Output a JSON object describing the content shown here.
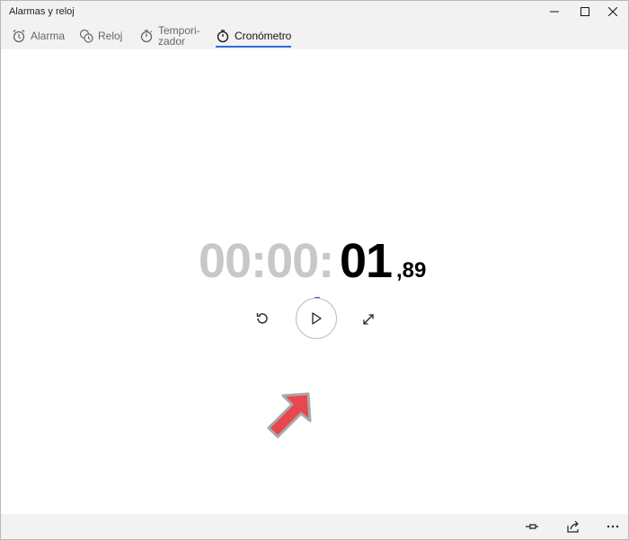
{
  "app": {
    "title": "Alarmas y reloj"
  },
  "tabs": [
    {
      "label": "Alarma",
      "icon": "alarm-icon",
      "active": false
    },
    {
      "label": "Reloj",
      "icon": "world-clock-icon",
      "active": false
    },
    {
      "label": "Tempori-\nzador",
      "icon": "timer-icon",
      "active": false
    },
    {
      "label": "Cronómetro",
      "icon": "stopwatch-icon",
      "active": true
    }
  ],
  "stopwatch": {
    "hours": "00",
    "sep1": ":",
    "minutes": "00",
    "sep2": ":",
    "seconds": "01",
    "fraction": ",89"
  },
  "colors": {
    "accent": "#2a6cd9",
    "elapsed_grey": "#c8c8c8",
    "arrow": "#e8474f"
  }
}
